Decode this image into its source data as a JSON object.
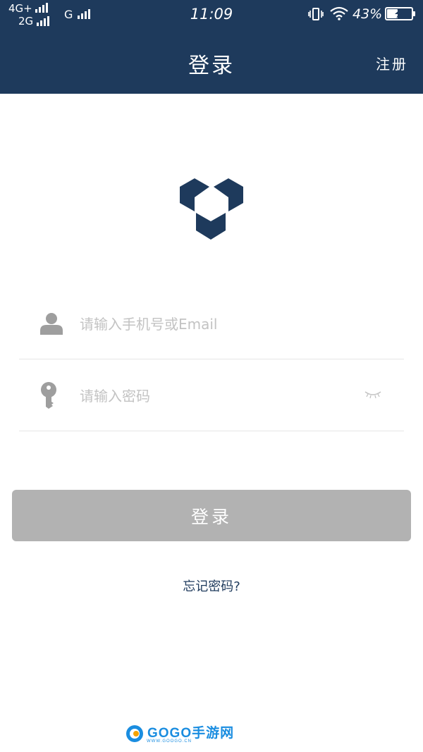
{
  "status_bar": {
    "network_primary": "4G+",
    "network_secondary": "2G",
    "network_tertiary": "G",
    "time": "11:09",
    "battery_percent": "43%",
    "battery_level": 0.43,
    "icons": [
      "signal-icon",
      "vibrate-icon",
      "wifi-icon",
      "battery-charging-icon"
    ]
  },
  "header": {
    "title": "登录",
    "register_label": "注册",
    "background": "#1e3a5c"
  },
  "logo": {
    "icon": "hexagon-cube-logo",
    "color": "#1e3a5c"
  },
  "form": {
    "username": {
      "placeholder": "请输入手机号或Email",
      "value": "",
      "icon": "user-icon"
    },
    "password": {
      "placeholder": "请输入密码",
      "value": "",
      "icon": "key-icon",
      "toggle_icon": "eye-closed-icon"
    },
    "submit_label": "登录",
    "forgot_label": "忘记密码?"
  },
  "watermark": {
    "text": "GOGO手游网",
    "subtext": "WWW.GOOGO.CN"
  }
}
